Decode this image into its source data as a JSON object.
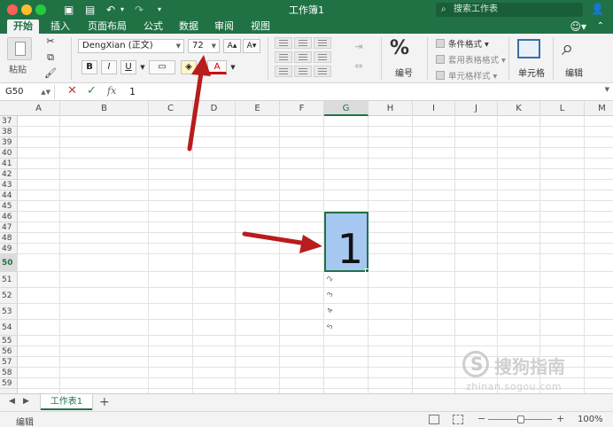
{
  "window": {
    "title": "工作簿1",
    "search_placeholder": "搜索工作表",
    "share_icon": "add-person-icon"
  },
  "tabs": [
    {
      "label": "开始",
      "active": true
    },
    {
      "label": "插入"
    },
    {
      "label": "页面布局"
    },
    {
      "label": "公式"
    },
    {
      "label": "数据"
    },
    {
      "label": "审阅"
    },
    {
      "label": "视图"
    }
  ],
  "ribbon": {
    "paste_label": "粘贴",
    "font_name": "DengXian (正文)",
    "font_size": "72",
    "bold": "B",
    "italic": "I",
    "underline": "U",
    "grow_font": "A▴",
    "shrink_font": "A▾",
    "font_color_letter": "A",
    "number_label": "编号",
    "number_symbol": "%",
    "conditional_format": "条件格式",
    "table_format": "套用表格格式",
    "cell_styles": "单元格样式",
    "cells_label": "单元格",
    "editing_label": "编辑"
  },
  "formula_bar": {
    "name_box": "G50",
    "fx": "fx",
    "value": "1"
  },
  "columns": [
    "A",
    "B",
    "C",
    "D",
    "E",
    "F",
    "G",
    "H",
    "I",
    "J",
    "K",
    "L",
    "M"
  ],
  "rows": [
    "37",
    "38",
    "39",
    "40",
    "41",
    "42",
    "43",
    "44",
    "45",
    "46",
    "47",
    "48",
    "49",
    "50",
    "51",
    "52",
    "53",
    "54",
    "55",
    "56",
    "57",
    "58",
    "59"
  ],
  "selected": {
    "column": "G",
    "row": "50",
    "value": "1"
  },
  "fill_hints": [
    "2",
    "3",
    "4",
    "5"
  ],
  "watermark": {
    "text": "搜狗指南",
    "url": "zhinan.sogou.com"
  },
  "sheets": [
    {
      "label": "工作表1",
      "active": true
    }
  ],
  "add_sheet": "+",
  "status": {
    "mode": "编辑",
    "zoom": "100%"
  },
  "colors": {
    "accent": "#207245",
    "selection": "#a6c8f0",
    "arrow": "#b81c1c"
  }
}
